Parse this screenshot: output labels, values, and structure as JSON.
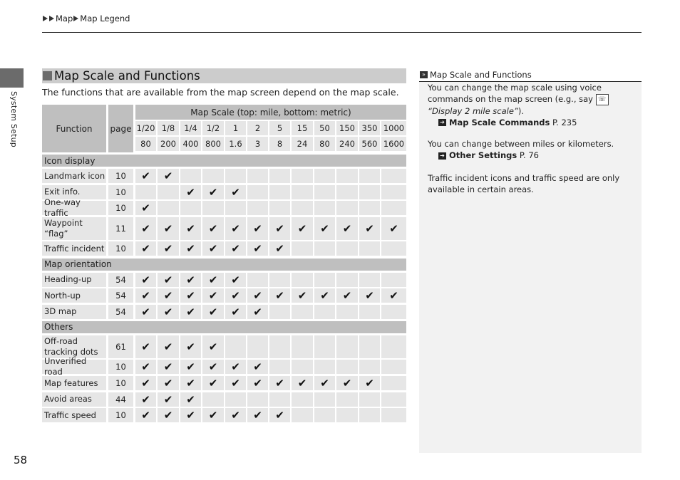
{
  "breadcrumb": [
    "Map",
    "Map Legend"
  ],
  "side_tab": {
    "label": "System Setup"
  },
  "section": {
    "title": "Map Scale and Functions",
    "intro": "The functions that are available from the map screen depend on the map scale."
  },
  "table": {
    "headers": {
      "function": "Function",
      "page": "page",
      "scale": "Map Scale (top: mile, bottom: metric)"
    },
    "scale_mile": [
      "1/20",
      "1/8",
      "1/4",
      "1/2",
      "1",
      "2",
      "5",
      "15",
      "50",
      "150",
      "350",
      "1000"
    ],
    "scale_metric": [
      "80",
      "200",
      "400",
      "800",
      "1.6",
      "3",
      "8",
      "24",
      "80",
      "240",
      "560",
      "1600"
    ],
    "check_glyph": "✔",
    "groups": [
      {
        "label": "Icon display",
        "rows": [
          {
            "name": "Landmark icon",
            "page": "10",
            "checks": [
              1,
              1,
              0,
              0,
              0,
              0,
              0,
              0,
              0,
              0,
              0,
              0
            ]
          },
          {
            "name": "Exit info.",
            "page": "10",
            "checks": [
              0,
              0,
              1,
              1,
              1,
              0,
              0,
              0,
              0,
              0,
              0,
              0
            ]
          },
          {
            "name": "One-way traffic",
            "page": "10",
            "checks": [
              1,
              0,
              0,
              0,
              0,
              0,
              0,
              0,
              0,
              0,
              0,
              0
            ]
          },
          {
            "name": "Waypoint “flag”",
            "page": "11",
            "checks": [
              1,
              1,
              1,
              1,
              1,
              1,
              1,
              1,
              1,
              1,
              1,
              1
            ],
            "tall": true
          },
          {
            "name": "Traffic incident",
            "page": "10",
            "checks": [
              1,
              1,
              1,
              1,
              1,
              1,
              1,
              0,
              0,
              0,
              0,
              0
            ]
          }
        ]
      },
      {
        "label": "Map orientation",
        "rows": [
          {
            "name": "Heading-up",
            "page": "54",
            "checks": [
              1,
              1,
              1,
              1,
              1,
              0,
              0,
              0,
              0,
              0,
              0,
              0
            ]
          },
          {
            "name": "North-up",
            "page": "54",
            "checks": [
              1,
              1,
              1,
              1,
              1,
              1,
              1,
              1,
              1,
              1,
              1,
              1
            ]
          },
          {
            "name": "3D map",
            "page": "54",
            "checks": [
              1,
              1,
              1,
              1,
              1,
              1,
              0,
              0,
              0,
              0,
              0,
              0
            ]
          }
        ]
      },
      {
        "label": "Others",
        "rows": [
          {
            "name": "Off-road tracking dots",
            "page": "61",
            "checks": [
              1,
              1,
              1,
              1,
              0,
              0,
              0,
              0,
              0,
              0,
              0,
              0
            ],
            "tall": true
          },
          {
            "name": "Unverified road",
            "page": "10",
            "checks": [
              1,
              1,
              1,
              1,
              1,
              1,
              0,
              0,
              0,
              0,
              0,
              0
            ]
          },
          {
            "name": "Map features",
            "page": "10",
            "checks": [
              1,
              1,
              1,
              1,
              1,
              1,
              1,
              1,
              1,
              1,
              1,
              0
            ]
          },
          {
            "name": "Avoid areas",
            "page": "44",
            "checks": [
              1,
              1,
              1,
              0,
              0,
              0,
              0,
              0,
              0,
              0,
              0,
              0
            ]
          },
          {
            "name": "Traffic speed",
            "page": "10",
            "checks": [
              1,
              1,
              1,
              1,
              1,
              1,
              1,
              0,
              0,
              0,
              0,
              0
            ]
          }
        ]
      }
    ]
  },
  "note": {
    "heading": "Map Scale and Functions",
    "p1_a": "You can change the map scale using voice commands on the map screen (e.g., say",
    "p1_quote": "“Display 2 mile scale”",
    "p1_end": ").",
    "ref1_title": "Map Scale Commands",
    "ref1_page": "P. 235",
    "p2": "You can change between miles or kilometers.",
    "ref2_title": "Other Settings",
    "ref2_page": "P. 76",
    "p3": "Traffic incident icons and traffic speed are only available in certain areas."
  },
  "page_number": "58"
}
